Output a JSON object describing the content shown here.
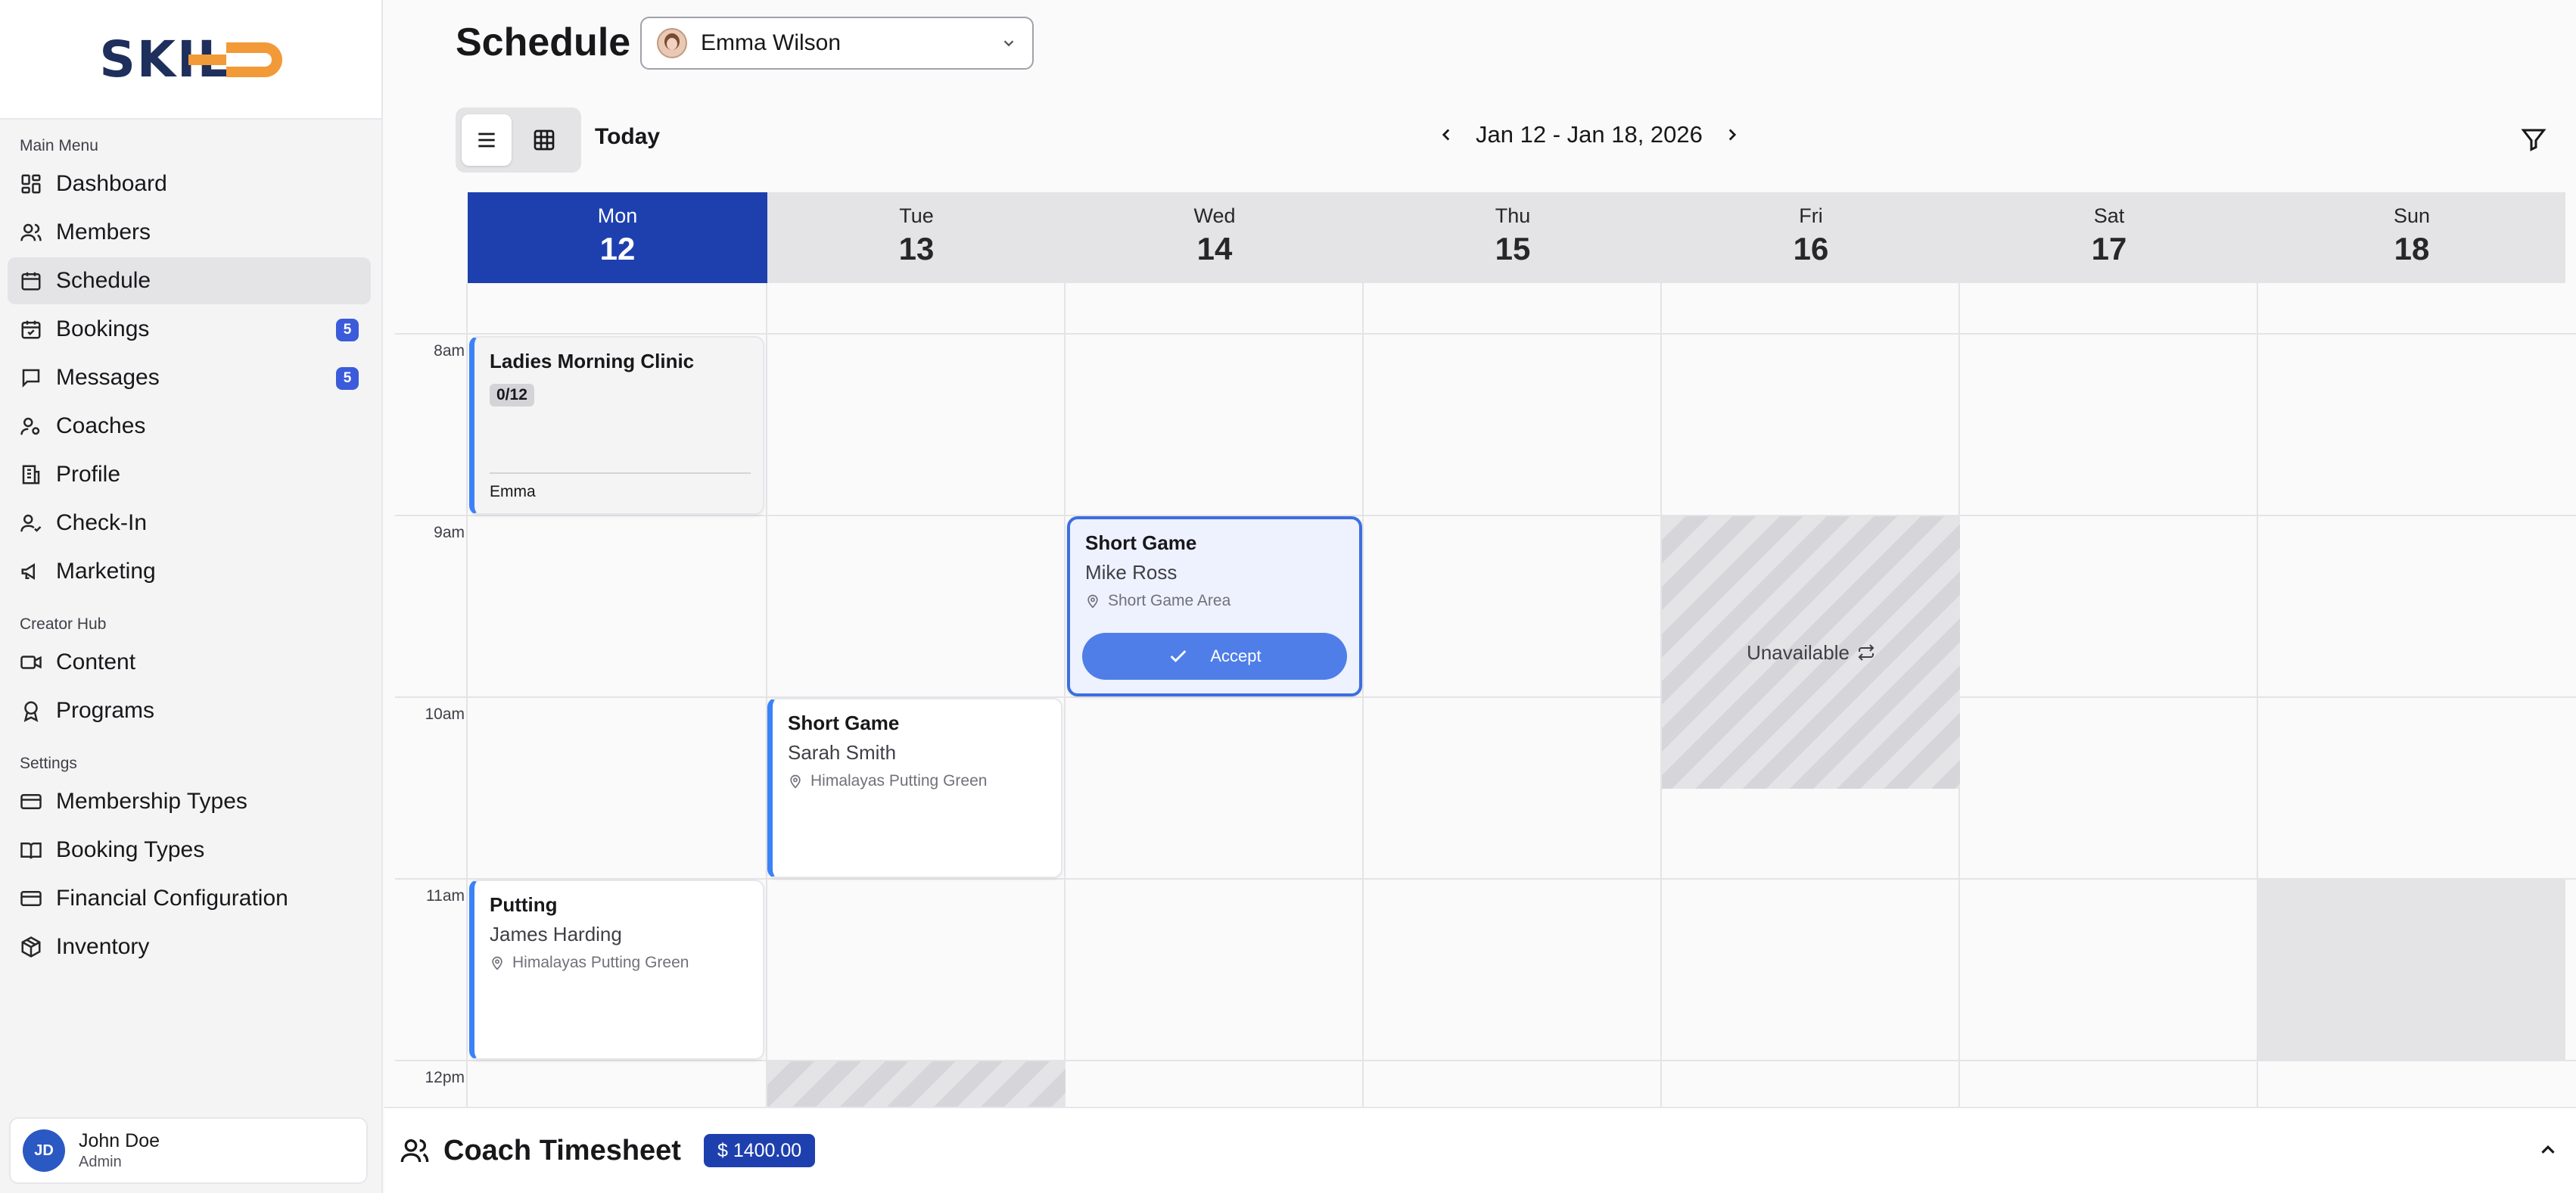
{
  "app": {
    "logo_text": "SKIL",
    "colors": {
      "brand": "#1f2f5c",
      "accent": "#f29a38",
      "primary": "#1e40af",
      "event_border": "#3b82f6"
    }
  },
  "sidebar": {
    "sections": [
      {
        "label": "Main Menu",
        "items": [
          {
            "label": "Dashboard",
            "icon": "dashboard-icon"
          },
          {
            "label": "Members",
            "icon": "users-icon"
          },
          {
            "label": "Schedule",
            "icon": "calendar-icon",
            "active": true
          },
          {
            "label": "Bookings",
            "icon": "calendar-check-icon",
            "badge": "5"
          },
          {
            "label": "Messages",
            "icon": "message-icon",
            "badge": "5"
          },
          {
            "label": "Coaches",
            "icon": "coach-icon"
          },
          {
            "label": "Profile",
            "icon": "building-icon"
          },
          {
            "label": "Check-In",
            "icon": "user-check-icon"
          },
          {
            "label": "Marketing",
            "icon": "megaphone-icon"
          }
        ]
      },
      {
        "label": "Creator Hub",
        "items": [
          {
            "label": "Content",
            "icon": "video-icon"
          },
          {
            "label": "Programs",
            "icon": "award-icon"
          }
        ]
      },
      {
        "label": "Settings",
        "items": [
          {
            "label": "Membership Types",
            "icon": "card-icon"
          },
          {
            "label": "Booking Types",
            "icon": "book-icon"
          },
          {
            "label": "Financial Configuration",
            "icon": "card-icon"
          },
          {
            "label": "Inventory",
            "icon": "package-icon"
          }
        ]
      }
    ],
    "user": {
      "initials": "JD",
      "name": "John Doe",
      "role": "Admin"
    }
  },
  "header": {
    "title": "Schedule",
    "coach_selected": "Emma Wilson",
    "today_label": "Today",
    "week_range": "Jan 12 - Jan 18, 2026"
  },
  "calendar": {
    "days": [
      {
        "name": "Mon",
        "num": "12",
        "active": true
      },
      {
        "name": "Tue",
        "num": "13"
      },
      {
        "name": "Wed",
        "num": "14"
      },
      {
        "name": "Thu",
        "num": "15"
      },
      {
        "name": "Fri",
        "num": "16"
      },
      {
        "name": "Sat",
        "num": "17"
      },
      {
        "name": "Sun",
        "num": "18"
      }
    ],
    "times": [
      "8am",
      "9am",
      "10am",
      "11am",
      "12pm"
    ],
    "events": {
      "ladies_clinic": {
        "title": "Ladies Morning Clinic",
        "capacity": "0/12",
        "coach": "Emma"
      },
      "short_game_wed": {
        "title": "Short Game",
        "person": "Mike Ross",
        "location": "Short Game Area",
        "action": "Accept"
      },
      "short_game_tue": {
        "title": "Short Game",
        "person": "Sarah Smith",
        "location": "Himalayas Putting Green"
      },
      "putting_mon": {
        "title": "Putting",
        "person": "James Harding",
        "location": "Himalayas Putting Green"
      }
    },
    "unavailable_label": "Unavailable"
  },
  "timesheet": {
    "title": "Coach Timesheet",
    "amount": "$ 1400.00"
  }
}
